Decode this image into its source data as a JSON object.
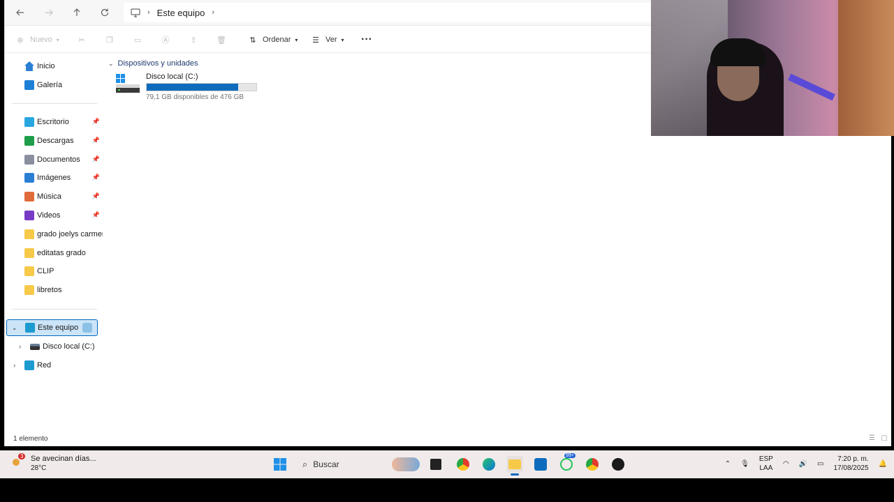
{
  "address_bar": {
    "crumbs": [
      "Este equipo"
    ]
  },
  "toolbar": {
    "new_label": "Nuevo",
    "sort_label": "Ordenar",
    "view_label": "Ver",
    "more_label": "···"
  },
  "sidebar": {
    "home": "Inicio",
    "gallery": "Galería",
    "quick_access": [
      {
        "label": "Escritorio",
        "color": "#2aa7e0"
      },
      {
        "label": "Descargas",
        "color": "#1e9e4a"
      },
      {
        "label": "Documentos",
        "color": "#8a8fa0"
      },
      {
        "label": "Imágenes",
        "color": "#2a7fd4"
      },
      {
        "label": "Música",
        "color": "#e06a3a"
      },
      {
        "label": "Videos",
        "color": "#7a3ac8"
      }
    ],
    "folders": [
      "grado joelys carmen",
      "editatas grado",
      "CLIP",
      "libretos"
    ],
    "this_pc": "Este equipo",
    "local_disk": "Disco local (C:)",
    "network": "Red"
  },
  "content": {
    "group_header": "Dispositivos y unidades",
    "drive": {
      "name": "Disco local (C:)",
      "free_text": "79,1 GB disponibles de 476 GB",
      "used_fraction": 0.834
    }
  },
  "status": {
    "count": "1 elemento"
  },
  "taskbar": {
    "weather_badge": "3",
    "weather_line1": "Se avecinan días...",
    "weather_line2": "28°C",
    "search_label": "Buscar",
    "whatsapp_badge": "99+",
    "lang_line1": "ESP",
    "lang_line2": "LAA",
    "time": "7:20 p. m.",
    "date": "17/08/2025"
  }
}
